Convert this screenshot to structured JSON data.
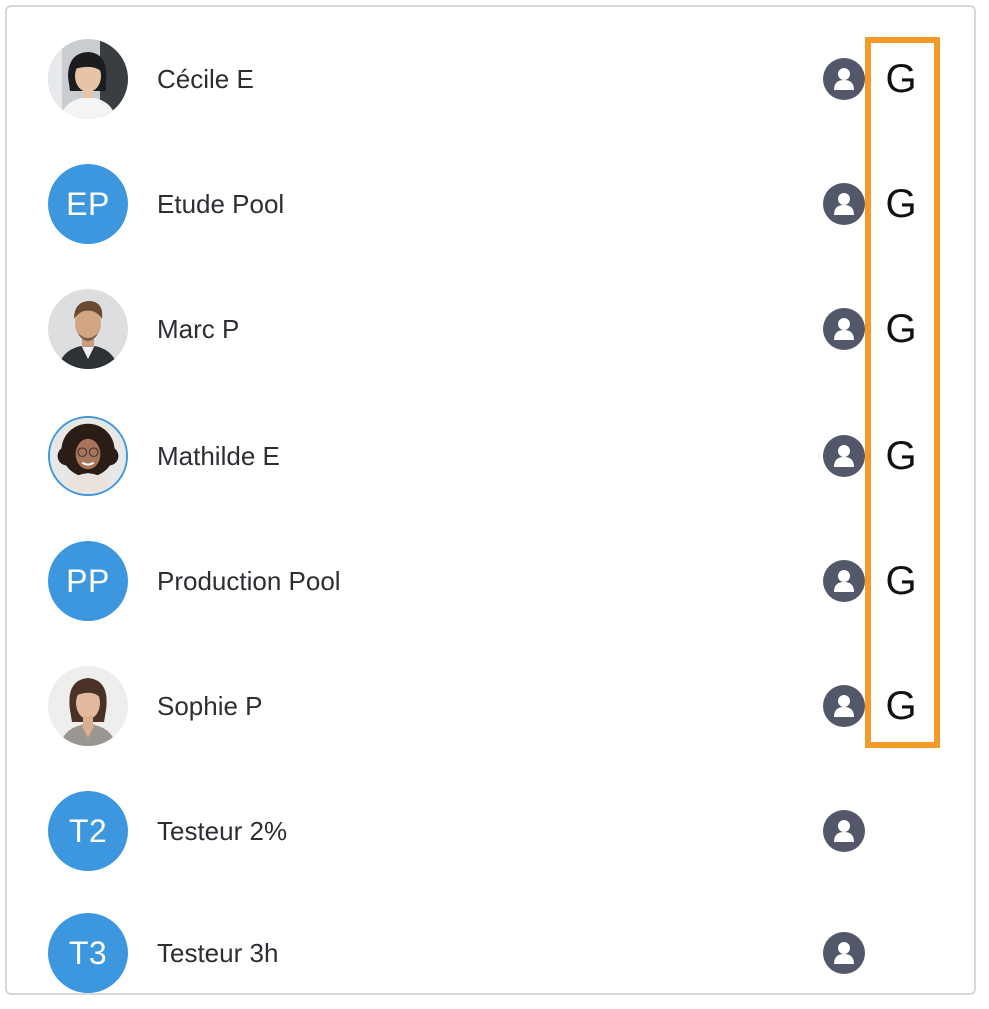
{
  "members": [
    {
      "name": "Cécile E",
      "avatar": {
        "type": "photo",
        "icon": "woman-portrait-photo"
      },
      "role_icon": "user-badge-icon",
      "group_letter": "G"
    },
    {
      "name": "Etude Pool",
      "avatar": {
        "type": "initials",
        "initials": "EP"
      },
      "role_icon": "user-badge-icon",
      "group_letter": "G"
    },
    {
      "name": "Marc P",
      "avatar": {
        "type": "photo",
        "icon": "man-portrait-photo"
      },
      "role_icon": "user-badge-icon",
      "group_letter": "G"
    },
    {
      "name": "Mathilde E",
      "avatar": {
        "type": "photo",
        "icon": "woman-curly-hair-portrait-photo"
      },
      "role_icon": "user-badge-icon",
      "group_letter": "G"
    },
    {
      "name": "Production Pool",
      "avatar": {
        "type": "initials",
        "initials": "PP"
      },
      "role_icon": "user-badge-icon",
      "group_letter": "G"
    },
    {
      "name": "Sophie P",
      "avatar": {
        "type": "photo",
        "icon": "woman-portrait-photo"
      },
      "role_icon": "user-badge-icon",
      "group_letter": "G"
    },
    {
      "name": "Testeur 2%",
      "avatar": {
        "type": "initials",
        "initials": "T2"
      },
      "role_icon": "user-badge-icon",
      "group_letter": ""
    },
    {
      "name": "Testeur 3h",
      "avatar": {
        "type": "initials",
        "initials": "T3"
      },
      "role_icon": "user-badge-icon",
      "group_letter": ""
    }
  ],
  "colors": {
    "avatar_initials_bg": "#3d97df",
    "role_icon_bg": "#525869",
    "highlight_border": "#f39a2b",
    "text": "#2b2f33"
  }
}
